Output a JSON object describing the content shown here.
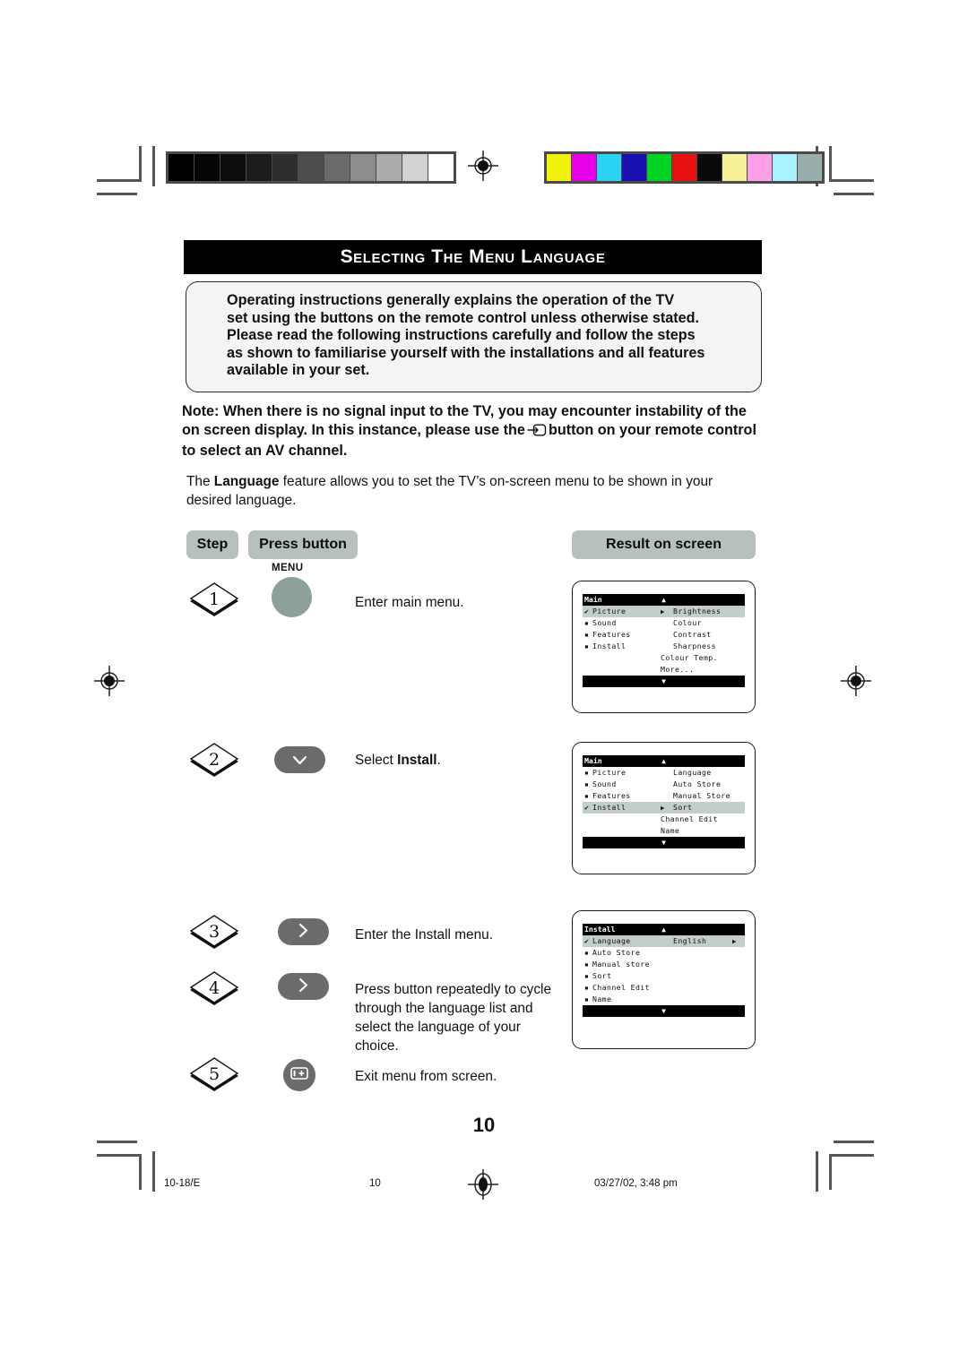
{
  "title": "Selecting the Menu Language",
  "intro": {
    "lines": [
      "Operating instructions generally explains the operation of the TV",
      "set using the buttons on the remote control unless otherwise stated.",
      "Please read the following instructions carefully and follow the steps",
      "as shown to familiarise yourself with the installations and all features",
      "available in your set."
    ]
  },
  "note": {
    "part1": "Note: When there is no signal input to the TV, you may encounter instability of the on screen display. In this instance, please use the",
    "icon": "av-input-icon",
    "part2": "button on your remote control to select an AV channel."
  },
  "language_paragraph": {
    "before": "The ",
    "bold": "Language",
    "after": " feature allows you to set the TV’s on-screen menu to be shown in your desired language."
  },
  "table": {
    "headers": {
      "step": "Step",
      "press_button": "Press button",
      "result": "Result on screen"
    },
    "rows": [
      {
        "step": "1",
        "button": {
          "type": "circle",
          "label": "MENU",
          "icon": "menu-button"
        },
        "description": "Enter main menu."
      },
      {
        "step": "2",
        "button": {
          "type": "pill",
          "icon": "chevron-down-icon",
          "glyph": "⌄"
        },
        "description_before": "Select ",
        "description_bold": "Install",
        "description_after": "."
      },
      {
        "step": "3",
        "button": {
          "type": "pill",
          "icon": "chevron-right-icon",
          "glyph": "›"
        },
        "description": "Enter the Install menu."
      },
      {
        "step": "4",
        "button": {
          "type": "pill",
          "icon": "chevron-right-icon",
          "glyph": "›"
        },
        "description": "Press button repeatedly to cycle through the language list and select the language of your choice."
      },
      {
        "step": "5",
        "button": {
          "type": "round",
          "icon": "av-input-icon"
        },
        "description": "Exit menu from screen."
      }
    ]
  },
  "screens": [
    {
      "id": "main-picture",
      "title": "Main",
      "up_arrow": "▲",
      "down_arrow": "▼",
      "items": [
        {
          "mark": "✔",
          "label": "Picture",
          "arrow": "▶",
          "right": "Brightness",
          "selected": true
        },
        {
          "mark": "▪",
          "label": "Sound",
          "arrow": "",
          "right": "Colour",
          "selected": false
        },
        {
          "mark": "▪",
          "label": "Features",
          "arrow": "",
          "right": "Contrast",
          "selected": false
        },
        {
          "mark": "▪",
          "label": "Install",
          "arrow": "",
          "right": "Sharpness",
          "selected": false
        }
      ],
      "extra_right": [
        "Colour Temp.",
        "More..."
      ]
    },
    {
      "id": "main-install",
      "title": "Main",
      "up_arrow": "▲",
      "down_arrow": "▼",
      "items": [
        {
          "mark": "▪",
          "label": "Picture",
          "arrow": "",
          "right": "Language",
          "selected": false
        },
        {
          "mark": "▪",
          "label": "Sound",
          "arrow": "",
          "right": "Auto Store",
          "selected": false
        },
        {
          "mark": "▪",
          "label": "Features",
          "arrow": "",
          "right": "Manual Store",
          "selected": false
        },
        {
          "mark": "✔",
          "label": "Install",
          "arrow": "▶",
          "right": "Sort",
          "selected": true
        }
      ],
      "extra_right": [
        "Channel Edit",
        "Name"
      ]
    },
    {
      "id": "install-language",
      "title": "Install",
      "up_arrow": "▲",
      "down_arrow": "▼",
      "items": [
        {
          "mark": "✔",
          "label": "Language",
          "arrow": "",
          "right": "English",
          "trailing_arrow": "▶",
          "selected": true
        },
        {
          "mark": "▪",
          "label": "Auto Store",
          "arrow": "",
          "right": "",
          "selected": false
        },
        {
          "mark": "▪",
          "label": "Manual store",
          "arrow": "",
          "right": "",
          "selected": false
        },
        {
          "mark": "▪",
          "label": "Sort",
          "arrow": "",
          "right": "",
          "selected": false
        },
        {
          "mark": "▪",
          "label": "Channel Edit",
          "arrow": "",
          "right": "",
          "selected": false
        },
        {
          "mark": "▪",
          "label": "Name",
          "arrow": "",
          "right": "",
          "selected": false
        }
      ],
      "extra_right": []
    }
  ],
  "page_number": "10",
  "footer": {
    "left": "10-18/E",
    "center": "10",
    "right": "03/27/02, 3:48 pm"
  },
  "calibration": {
    "grayscale": [
      "#000000",
      "#050505",
      "#0d0d0d",
      "#1c1c1c",
      "#2e2e2e",
      "#4d4d4d",
      "#6b6b6b",
      "#8c8c8c",
      "#ababab",
      "#d2d2d2",
      "#ffffff"
    ],
    "colors": [
      "#f2f20d",
      "#e800e8",
      "#2ad4f2",
      "#1a0fb0",
      "#00d422",
      "#e81010",
      "#0a0a0a",
      "#f5f29a",
      "#ff9fe8",
      "#a8f2ff",
      "#9aadad"
    ]
  }
}
